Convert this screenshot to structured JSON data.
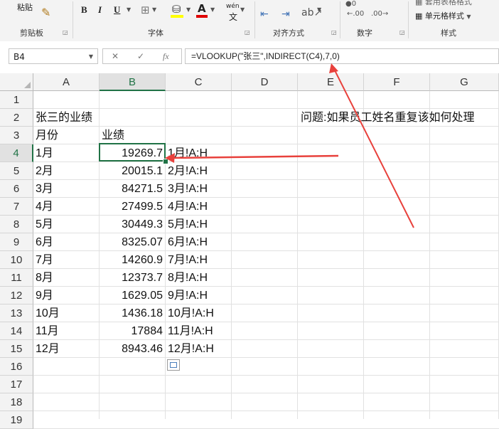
{
  "ribbon": {
    "paste_label": "粘贴",
    "clipboard_label": "剪贴板",
    "font_label": "字体",
    "align_label": "对齐方式",
    "number_label": "数字",
    "styles_label": "样式",
    "font_buttons": [
      "B",
      "I",
      "U"
    ],
    "phonetic_label": "wén",
    "cell_styles_label": "单元格样式",
    "table_format_label": "套用表格格式"
  },
  "formula_bar": {
    "name_box": "B4",
    "formula": "=VLOOKUP(\"张三\",INDIRECT(C4),7,0)",
    "cancel_icon": "✕",
    "enter_icon": "✓",
    "fx_label": "fx"
  },
  "columns": [
    "A",
    "B",
    "C",
    "D",
    "E",
    "F",
    "G"
  ],
  "rows": [
    "1",
    "2",
    "3",
    "4",
    "5",
    "6",
    "7",
    "8",
    "9",
    "10",
    "11",
    "12",
    "13",
    "14",
    "15",
    "16",
    "17",
    "18",
    "19"
  ],
  "sheet": {
    "title": "张三的业绩",
    "question": "问题:如果员工姓名重复该如何处理",
    "header_month": "月份",
    "header_perf": "业绩",
    "records": [
      {
        "month": "1月",
        "value": "19269.7",
        "ref": "1月!A:H"
      },
      {
        "month": "2月",
        "value": "20015.1",
        "ref": "2月!A:H"
      },
      {
        "month": "3月",
        "value": "84271.5",
        "ref": "3月!A:H"
      },
      {
        "month": "4月",
        "value": "27499.5",
        "ref": "4月!A:H"
      },
      {
        "month": "5月",
        "value": "30449.3",
        "ref": "5月!A:H"
      },
      {
        "month": "6月",
        "value": "8325.07",
        "ref": "6月!A:H"
      },
      {
        "month": "7月",
        "value": "14260.9",
        "ref": "7月!A:H"
      },
      {
        "month": "8月",
        "value": "12373.7",
        "ref": "8月!A:H"
      },
      {
        "month": "9月",
        "value": "1629.05",
        "ref": "9月!A:H"
      },
      {
        "month": "10月",
        "value": "1436.18",
        "ref": "10月!A:H"
      },
      {
        "month": "11月",
        "value": "17884",
        "ref": "11月!A:H"
      },
      {
        "month": "12月",
        "value": "8943.46",
        "ref": "12月!A:H"
      }
    ]
  },
  "colors": {
    "accent": "#217346",
    "annotation": "#e8413c"
  }
}
